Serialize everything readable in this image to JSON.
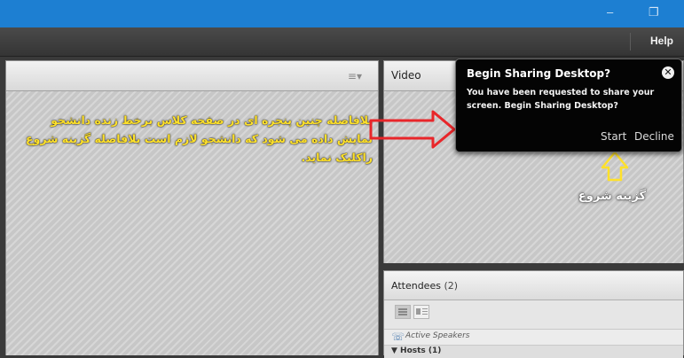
{
  "titlebar": {
    "minimize_glyph": "–",
    "restore_glyph": "❐"
  },
  "menubar": {
    "help_label": "Help"
  },
  "left_pod": {
    "menu_icon": "≡▾"
  },
  "video_pod": {
    "title": "Video"
  },
  "dialog": {
    "title": "Begin Sharing Desktop?",
    "message": "You have been requested to share your screen. Begin Sharing Desktop?",
    "start_label": "Start",
    "decline_label": "Decline",
    "close_glyph": "✕"
  },
  "attendees_pod": {
    "title": "Attendees",
    "count": "(2)",
    "active_speakers_label": "Active Speakers",
    "hosts_label": "▼ Hosts (1)"
  },
  "annotations": {
    "instruction": "بلافاصله چنین پنجره ای در صفحه کلاس برخط زنده دانشجو نمایش داده می شود که دانشجو لازم است بلافاصله گزینه شروع راکلیک نماید.",
    "start_option": "گزینه شروع",
    "arrow_color": "#e8262a",
    "up_arrow_color": "#ffe12a"
  }
}
